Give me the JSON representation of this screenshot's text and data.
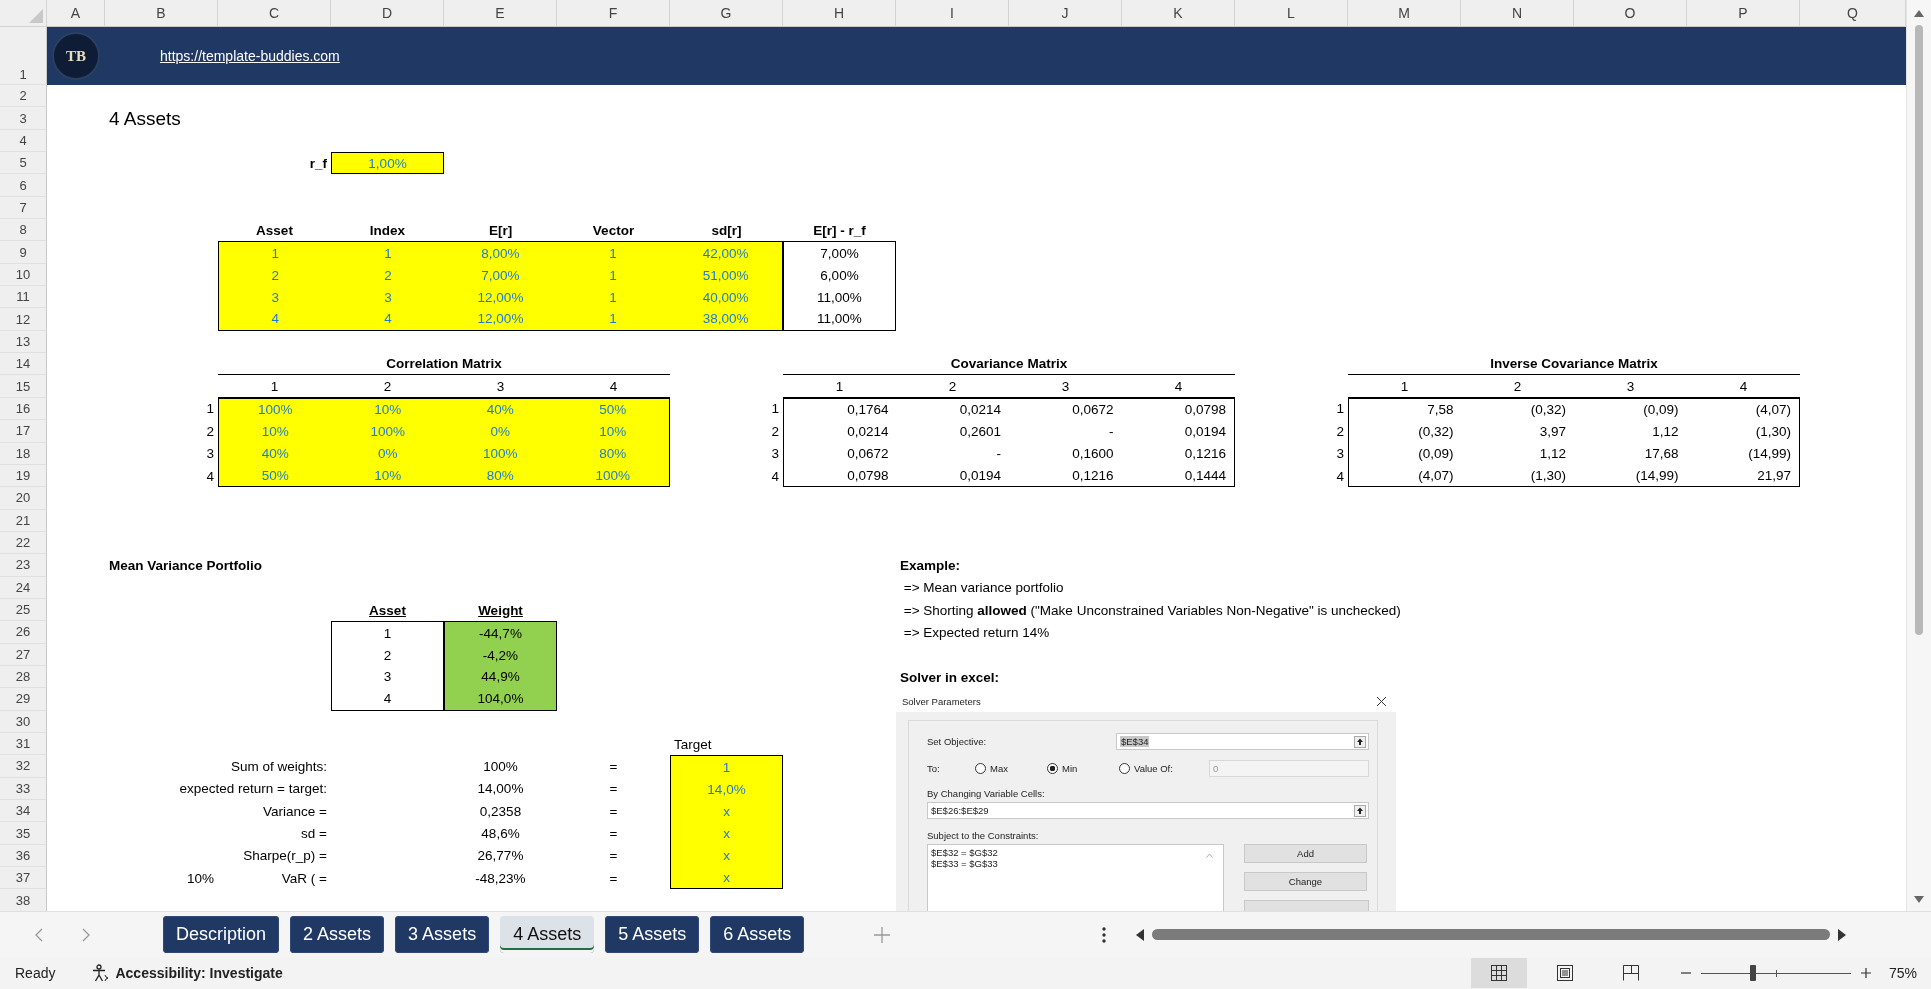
{
  "column_headers": [
    "A",
    "B",
    "C",
    "D",
    "E",
    "F",
    "G",
    "H",
    "I",
    "J",
    "K",
    "L",
    "M",
    "N",
    "O",
    "P",
    "Q"
  ],
  "row_numbers": [
    "1",
    "2",
    "3",
    "4",
    "5",
    "6",
    "7",
    "8",
    "9",
    "10",
    "11",
    "12",
    "13",
    "14",
    "15",
    "16",
    "17",
    "18",
    "19",
    "20",
    "21",
    "22",
    "23",
    "24",
    "25",
    "26",
    "27",
    "28",
    "29",
    "30",
    "31",
    "32",
    "33",
    "34",
    "35",
    "36",
    "37",
    "38"
  ],
  "banner": {
    "logo": "TB",
    "link": "https://template-buddies.com"
  },
  "sheet_title": "4 Assets",
  "risk_free": {
    "label": "r_f",
    "value": "1,00%"
  },
  "assets_table": {
    "columns": [
      "Asset",
      "Index",
      "E[r]",
      "Vector",
      "sd[r]",
      "E[r] - r_f"
    ],
    "rows": [
      [
        "1",
        "1",
        "8,00%",
        "1",
        "42,00%",
        "7,00%"
      ],
      [
        "2",
        "2",
        "7,00%",
        "1",
        "51,00%",
        "6,00%"
      ],
      [
        "3",
        "3",
        "12,00%",
        "1",
        "40,00%",
        "11,00%"
      ],
      [
        "4",
        "4",
        "12,00%",
        "1",
        "38,00%",
        "11,00%"
      ]
    ]
  },
  "correlation_matrix": {
    "title": "Correlation Matrix",
    "kind": "input",
    "columns": [
      "1",
      "2",
      "3",
      "4"
    ],
    "row_labels": [
      "1",
      "2",
      "3",
      "4"
    ],
    "rows": [
      [
        "100%",
        "10%",
        "40%",
        "50%"
      ],
      [
        "10%",
        "100%",
        "0%",
        "10%"
      ],
      [
        "40%",
        "0%",
        "100%",
        "80%"
      ],
      [
        "50%",
        "10%",
        "80%",
        "100%"
      ]
    ]
  },
  "covariance_matrix": {
    "title": "Covariance Matrix",
    "kind": "output",
    "columns": [
      "1",
      "2",
      "3",
      "4"
    ],
    "row_labels": [
      "1",
      "2",
      "3",
      "4"
    ],
    "rows": [
      [
        "0,1764",
        "0,0214",
        "0,0672",
        "0,0798"
      ],
      [
        "0,0214",
        "0,2601",
        "-",
        "0,0194"
      ],
      [
        "0,0672",
        "-",
        "0,1600",
        "0,1216"
      ],
      [
        "0,0798",
        "0,0194",
        "0,1216",
        "0,1444"
      ]
    ]
  },
  "inverse_covariance_matrix": {
    "title": "Inverse Covariance Matrix",
    "kind": "output",
    "columns": [
      "1",
      "2",
      "3",
      "4"
    ],
    "row_labels": [
      "1",
      "2",
      "3",
      "4"
    ],
    "rows": [
      [
        "7,58",
        "(0,32)",
        "(0,09)",
        "(4,07)"
      ],
      [
        "(0,32)",
        "3,97",
        "1,12",
        "(1,30)"
      ],
      [
        "(0,09)",
        "1,12",
        "17,68",
        "(14,99)"
      ],
      [
        "(4,07)",
        "(1,30)",
        "(14,99)",
        "21,97"
      ]
    ]
  },
  "portfolio": {
    "title": "Mean Variance Portfolio",
    "columns": [
      "Asset",
      "Weight"
    ],
    "rows": [
      [
        "1",
        "-44,7%"
      ],
      [
        "2",
        "-4,2%"
      ],
      [
        "3",
        "44,9%"
      ],
      [
        "4",
        "104,0%"
      ]
    ]
  },
  "target_header": "Target",
  "constraints": [
    {
      "label": "Sum of weights:",
      "value": "100%",
      "sign": "=",
      "target": "1"
    },
    {
      "label": "expected return = target:",
      "value": "14,00%",
      "sign": "=",
      "target": "14,0%"
    },
    {
      "label": "Variance =",
      "value": "0,2358",
      "sign": "=",
      "target": "x"
    },
    {
      "label": "sd =",
      "value": "48,6%",
      "sign": "=",
      "target": "x"
    },
    {
      "label": "Sharpe(r_p) =",
      "value": "26,77%",
      "sign": "=",
      "target": "x"
    },
    {
      "prefix": "10%",
      "label": "VaR ( =",
      "value": "-48,23%",
      "sign": "=",
      "target": "x"
    }
  ],
  "example": {
    "title": "Example:",
    "lines": [
      " => Mean variance portfolio",
      " => Shorting **allowed** (\"Make Unconstrained Variables Non-Negative\" is unchecked)",
      " => Expected return 14%"
    ]
  },
  "solver_heading": "Solver in excel:",
  "solver": {
    "title": "Solver Parameters",
    "objective_label": "Set Objective:",
    "objective": "$E$34",
    "to_label": "To:",
    "objective_options": [
      {
        "label": "Max",
        "selected": false
      },
      {
        "label": "Min",
        "selected": true
      },
      {
        "label": "Value Of:",
        "selected": false
      }
    ],
    "value_of": {
      "value": "0",
      "disabled": true
    },
    "variables_label": "By Changing Variable Cells:",
    "variables": "$E$26:$E$29",
    "constraints_label": "Subject to the Constraints:",
    "constraints": [
      "$E$32 = $G$32",
      "$E$33 = $G$33"
    ],
    "buttons": [
      "Add",
      "Change"
    ]
  },
  "sheet_tabs": [
    {
      "label": "Description",
      "selected": false
    },
    {
      "label": "2 Assets",
      "selected": false
    },
    {
      "label": "3 Assets",
      "selected": false
    },
    {
      "label": "4 Assets",
      "selected": true
    },
    {
      "label": "5 Assets",
      "selected": false
    },
    {
      "label": "6 Assets",
      "selected": false
    }
  ],
  "status_bar": {
    "mode": "Ready",
    "accessibility": "Accessibility: Investigate",
    "views": [
      {
        "kind": "normal",
        "selected": true
      },
      {
        "kind": "page_layout",
        "selected": false
      },
      {
        "kind": "page_break",
        "selected": false
      }
    ],
    "zoom": {
      "level": 0.35,
      "reading": "75%"
    }
  }
}
